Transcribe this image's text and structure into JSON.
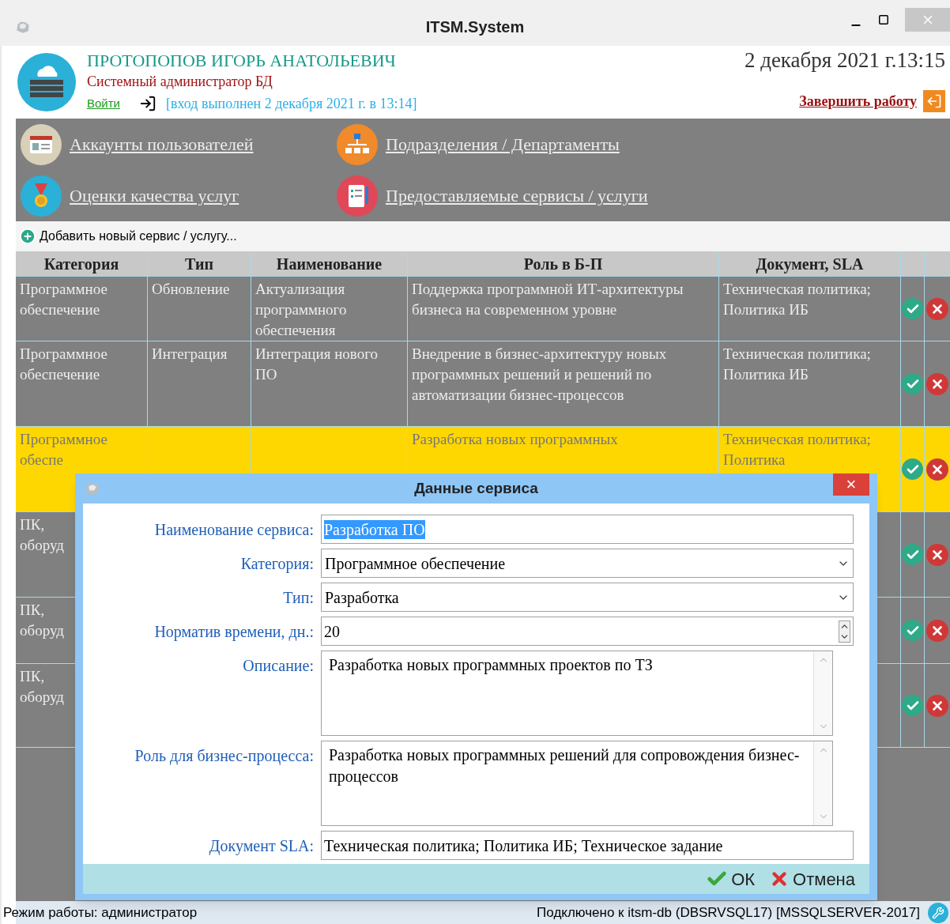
{
  "window": {
    "title": "ITSM.System"
  },
  "user": {
    "name": "ПРОТОПОПОВ ИГОРЬ АНАТОЛЬЕВИЧ",
    "role": "Системный администратор БД",
    "login_link": "Войти",
    "login_status": "[вход выполнен 2 декабря 2021 г. в 13:14]",
    "datetime": "2 декабря 2021 г.13:15",
    "logout": "Завершить работу"
  },
  "nav": [
    {
      "label": "Аккаунты пользователей"
    },
    {
      "label": "Подразделения / Департаменты"
    },
    {
      "label": "Оценки качества услуг"
    },
    {
      "label": "Предоставляемые сервисы / услуги"
    }
  ],
  "toolbar": {
    "add": "Добавить новый сервис / услугу..."
  },
  "table": {
    "columns": [
      "Категория",
      "Тип",
      "Наименование",
      "Роль в Б-П",
      "Документ, SLA"
    ],
    "rows": [
      {
        "selected": false,
        "category": "Программное обеспечение",
        "type": "Обновление",
        "name": "Актуализация программного обеспечения",
        "role": "Поддержка программной ИТ-архитектуры бизнеса на современном уровне",
        "document": "Техническая политика; Политика ИБ"
      },
      {
        "selected": false,
        "category": "Программное обеспечение",
        "type": "Интеграция",
        "name": "Интеграция нового ПО",
        "role": "Внедрение в бизнес-архитектуру новых программных решений и решений по автоматизации бизнес-процессов",
        "document": "Техническая политика; Политика ИБ"
      },
      {
        "selected": true,
        "category": "Программное обеспе",
        "role": "Разработка новых программных",
        "document": "Техническая политика; Политика"
      },
      {
        "selected": false,
        "category": "ПК, оборуд"
      },
      {
        "selected": false,
        "category": "ПК, оборуд"
      },
      {
        "selected": false,
        "category": "ПК, оборуд"
      }
    ]
  },
  "dialog": {
    "title": "Данные сервиса",
    "close": "×",
    "fields": [
      {
        "kind": "text",
        "label": "Наименование сервиса:",
        "value": "Разработка ПО",
        "highlighted": true
      },
      {
        "kind": "select",
        "label": "Категория:",
        "value": "Программное обеспечение",
        "highlighted": false
      },
      {
        "kind": "select",
        "label": "Тип:",
        "value": "Разработка",
        "highlighted": false
      },
      {
        "kind": "spin",
        "label": "Норматив времени, дн.:",
        "value": "20",
        "highlighted": false
      },
      {
        "kind": "textarea",
        "label": "Описание:",
        "value": "Разработка новых программных проектов по ТЗ",
        "highlighted": false
      },
      {
        "kind": "textarea",
        "label": "Роль для бизнес-процесса:",
        "value": "Разработка новых программных решений для сопровождения бизнес-процессов",
        "highlighted": false
      },
      {
        "kind": "text",
        "label": "Документ SLA:",
        "value": "Техническая политика; Политика ИБ; Техническое задание",
        "highlighted": false
      }
    ],
    "ok": "ОК",
    "cancel": "Отмена"
  },
  "status_bar": {
    "mode": "Режим работы: администратор",
    "connection": "Подключено к itsm-db (DBSRVSQL17) [MSSQLSERVER-2017]"
  }
}
